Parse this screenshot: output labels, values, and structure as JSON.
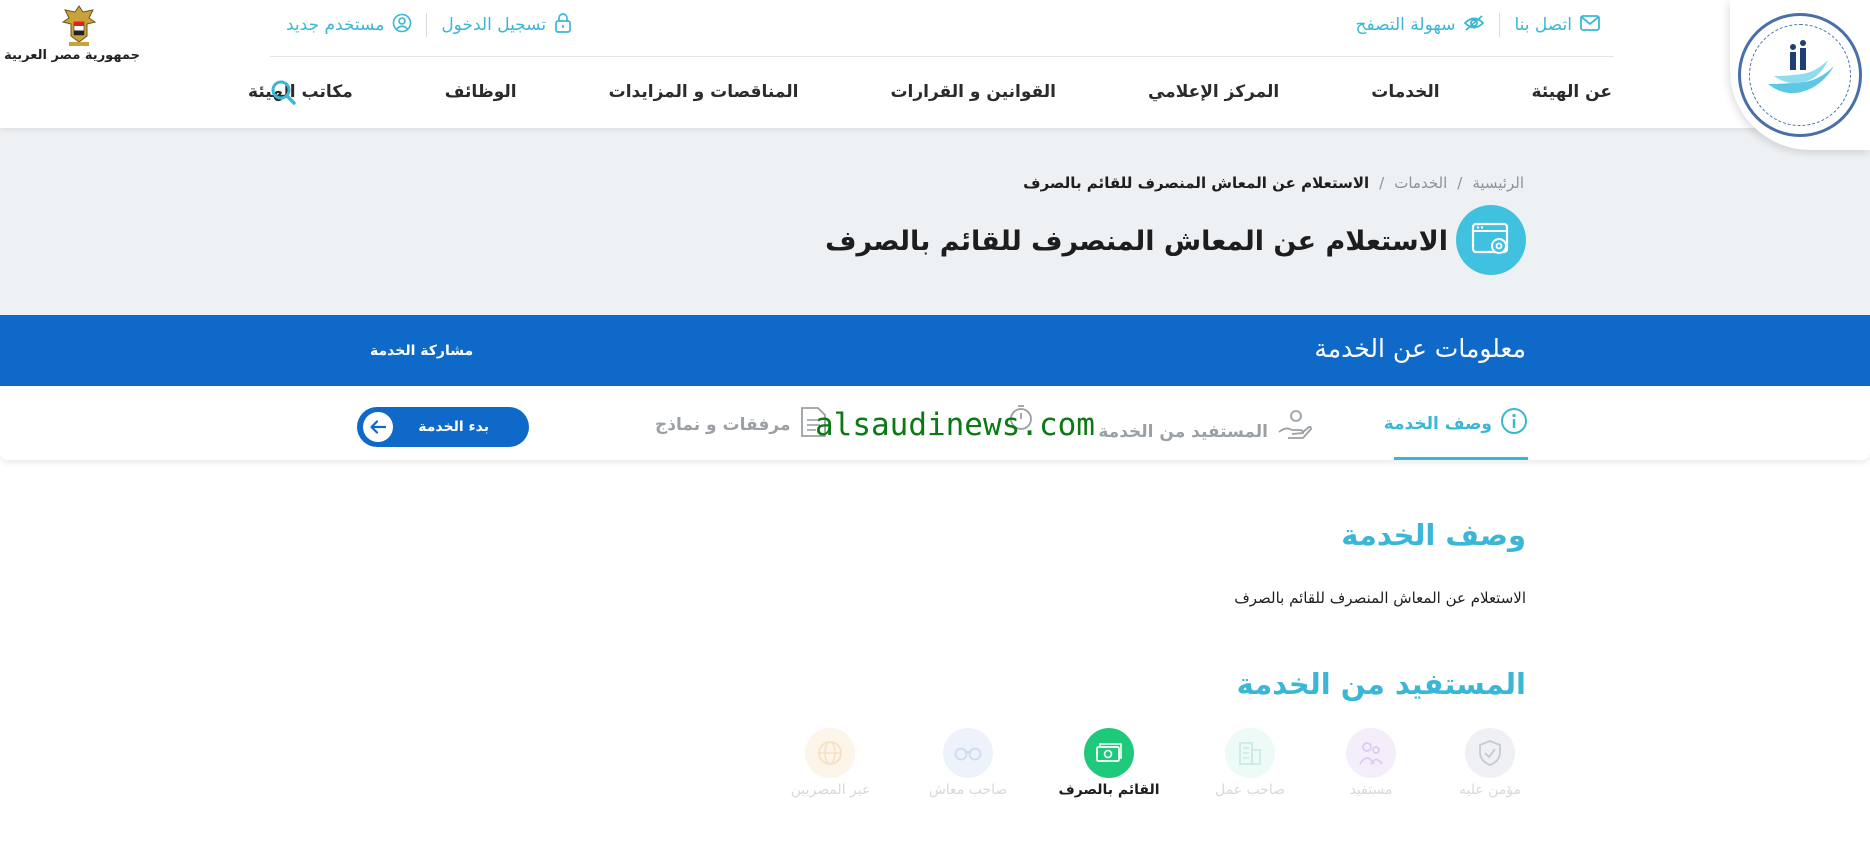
{
  "header": {
    "contact_label": "اتصل بنا",
    "accessibility_label": "سهولة التصفح",
    "new_user_label": "مستخدم جديد",
    "login_label": "تسجيل الدخول",
    "gov_caption": "جمهورية مصر العربية",
    "nav": [
      "عن الهيئة",
      "الخدمات",
      "المركز الإعلامي",
      "القوانين و القرارات",
      "المناقصات و المزايدات",
      "الوظائف",
      "مكاتب الهيئة"
    ]
  },
  "breadcrumb": {
    "home": "الرئيسية",
    "services": "الخدمات",
    "current": "الاستعلام عن المعاش المنصرف للقائم بالصرف"
  },
  "page_title": "الاستعلام عن المعاش المنصرف للقائم بالصرف",
  "info_bar": {
    "title": "معلومات عن الخدمة",
    "share_label": "مشاركة الخدمة"
  },
  "tabs": {
    "description": "وصف الخدمة",
    "beneficiary": "المستفيد من الخدمة",
    "attachments": "مرفقات و نماذج"
  },
  "start_button": "بدء الخدمة",
  "watermark": "alsaudinews.com",
  "content": {
    "desc_heading": "وصف الخدمة",
    "desc_text": "الاستعلام عن المعاش المنصرف للقائم بالصرف",
    "beneficiary_heading": "المستفيد من الخدمة"
  },
  "beneficiaries": [
    {
      "label": "مؤمن عليه",
      "selected": false,
      "color": "#eef0f3"
    },
    {
      "label": "مستفيد",
      "selected": false,
      "color": "#f4eefb"
    },
    {
      "label": "صاحب عمل",
      "selected": false,
      "color": "#eefaf8"
    },
    {
      "label": "القائم بالصرف",
      "selected": true,
      "color": "#1ec97b"
    },
    {
      "label": "صاحب معاش",
      "selected": false,
      "color": "#eef3fb"
    },
    {
      "label": "غير المصريين",
      "selected": false,
      "color": "#fdf4ea"
    }
  ],
  "colors": {
    "accent": "#3ab7d6",
    "primary_blue": "#0e69c9",
    "hero_bg": "#eef1f3"
  }
}
